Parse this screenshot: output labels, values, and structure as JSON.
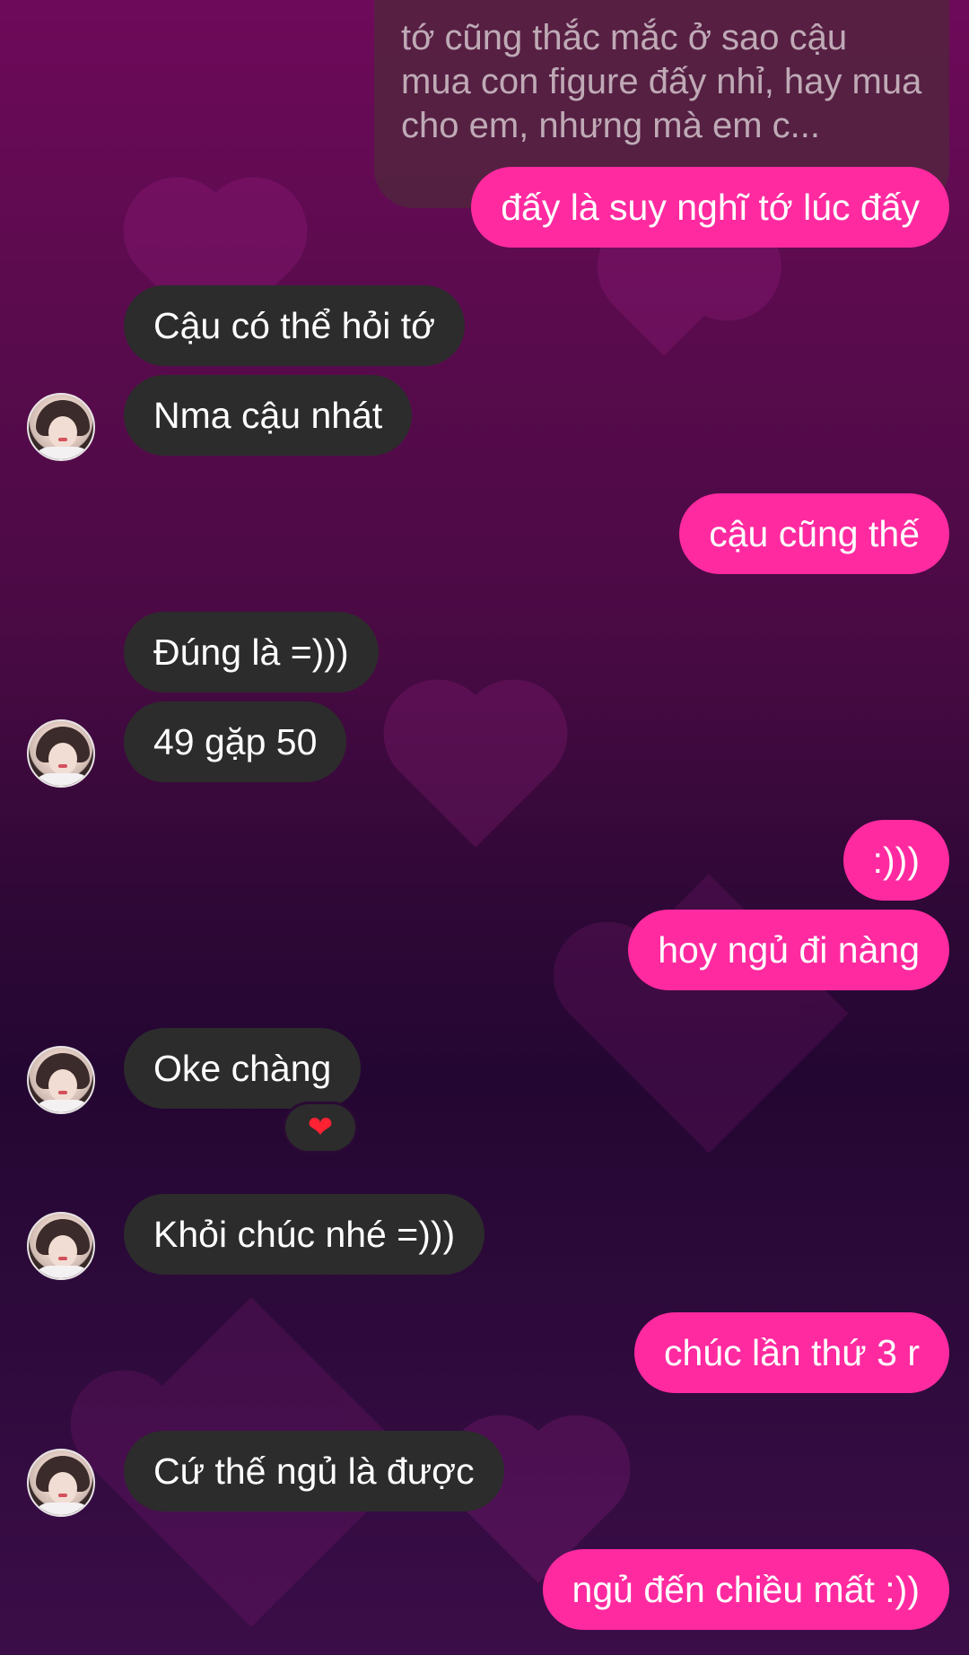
{
  "conversation": {
    "quoted_reply": "tớ cũng thắc mắc ở sao cậu mua con figure đấy nhỉ, hay mua cho em, nhưng mà em c...",
    "messages": [
      {
        "side": "sent",
        "text": "đấy là suy nghĩ tớ lúc đấy"
      },
      {
        "side": "received",
        "text": "Cậu có thể hỏi tớ"
      },
      {
        "side": "received",
        "text": "Nma cậu nhát"
      },
      {
        "side": "sent",
        "text": "cậu cũng thế"
      },
      {
        "side": "received",
        "text": "Đúng là =)))"
      },
      {
        "side": "received",
        "text": "49 gặp 50"
      },
      {
        "side": "sent",
        "text": ":)))"
      },
      {
        "side": "sent",
        "text": "hoy ngủ đi nàng"
      },
      {
        "side": "received",
        "text": "Oke chàng"
      },
      {
        "side": "received",
        "text": "Khỏi chúc nhé =)))"
      },
      {
        "side": "sent",
        "text": "chúc lần thứ 3 r"
      },
      {
        "side": "received",
        "text": "Cứ thế ngủ là được"
      },
      {
        "side": "sent",
        "text": "ngủ đến chiều mất :))"
      }
    ],
    "reaction_icon": "heart-icon",
    "reaction_symbol": "❤"
  },
  "colors": {
    "sent_bubble": "#ff2aa0",
    "received_bubble": "#2c2c2c",
    "text": "#ffffff"
  }
}
